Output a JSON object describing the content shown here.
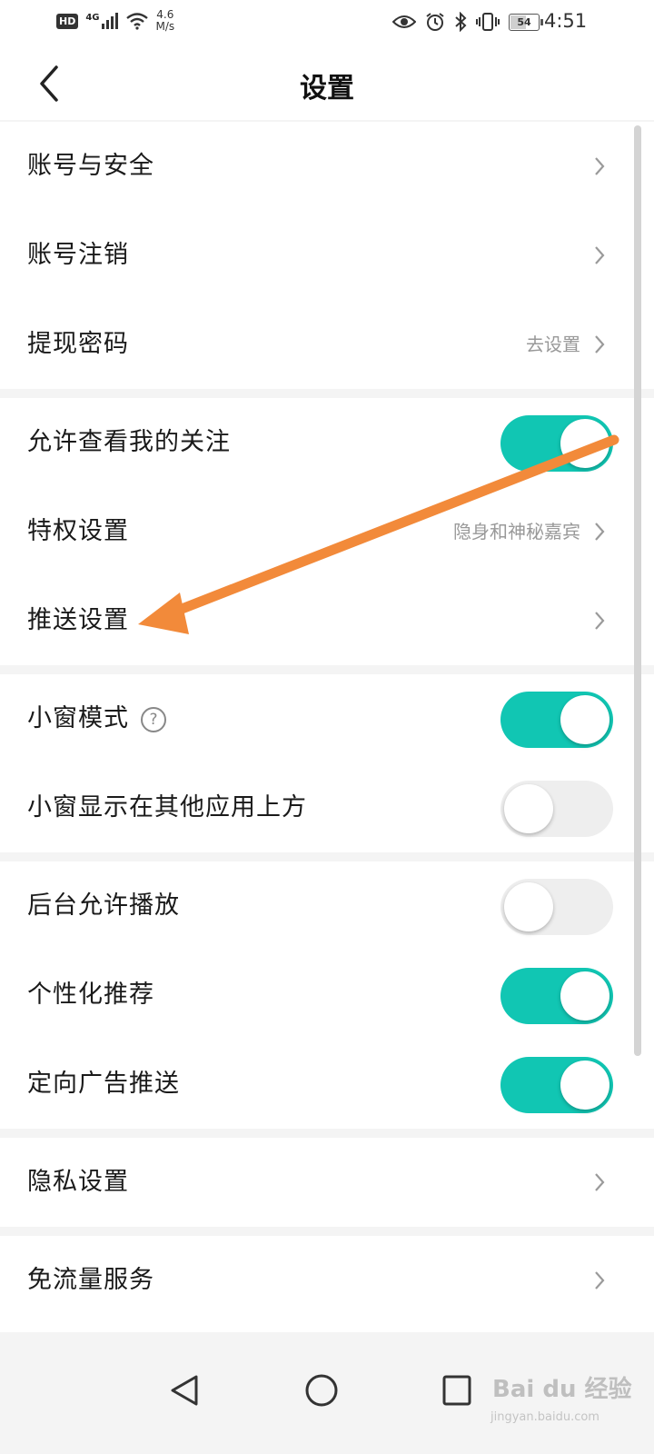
{
  "status_bar": {
    "hd": "HD",
    "network": "4G",
    "speed_value": "4.6",
    "speed_unit": "M/s",
    "battery": "54",
    "time": "4:51"
  },
  "header": {
    "title": "设置"
  },
  "groups": [
    {
      "items": [
        {
          "label": "账号与安全",
          "type": "link"
        },
        {
          "label": "账号注销",
          "type": "link"
        },
        {
          "label": "提现密码",
          "type": "link",
          "value": "去设置"
        }
      ]
    },
    {
      "items": [
        {
          "label": "允许查看我的关注",
          "type": "toggle",
          "on": true
        },
        {
          "label": "特权设置",
          "type": "link",
          "value": "隐身和神秘嘉宾"
        },
        {
          "label": "推送设置",
          "type": "link"
        }
      ]
    },
    {
      "items": [
        {
          "label": "小窗模式",
          "type": "toggle",
          "on": true,
          "help_icon": "?"
        },
        {
          "label": "小窗显示在其他应用上方",
          "type": "toggle",
          "on": false
        }
      ]
    },
    {
      "items": [
        {
          "label": "后台允许播放",
          "type": "toggle",
          "on": false
        },
        {
          "label": "个性化推荐",
          "type": "toggle",
          "on": true
        },
        {
          "label": "定向广告推送",
          "type": "toggle",
          "on": true
        }
      ]
    },
    {
      "items": [
        {
          "label": "隐私设置",
          "type": "link"
        }
      ]
    },
    {
      "items": [
        {
          "label": "免流量服务",
          "type": "link"
        }
      ]
    }
  ],
  "watermark": {
    "brand": "Bai du 经验",
    "url": "jingyan.baidu.com"
  },
  "colors": {
    "toggle_on": "#11c6b3",
    "toggle_off": "#eeeeee",
    "annotation_arrow": "#f28a3a"
  },
  "icons": {
    "back": "chevron-left-icon",
    "row_arrow": "chevron-right-icon",
    "help": "question-circle-icon"
  }
}
